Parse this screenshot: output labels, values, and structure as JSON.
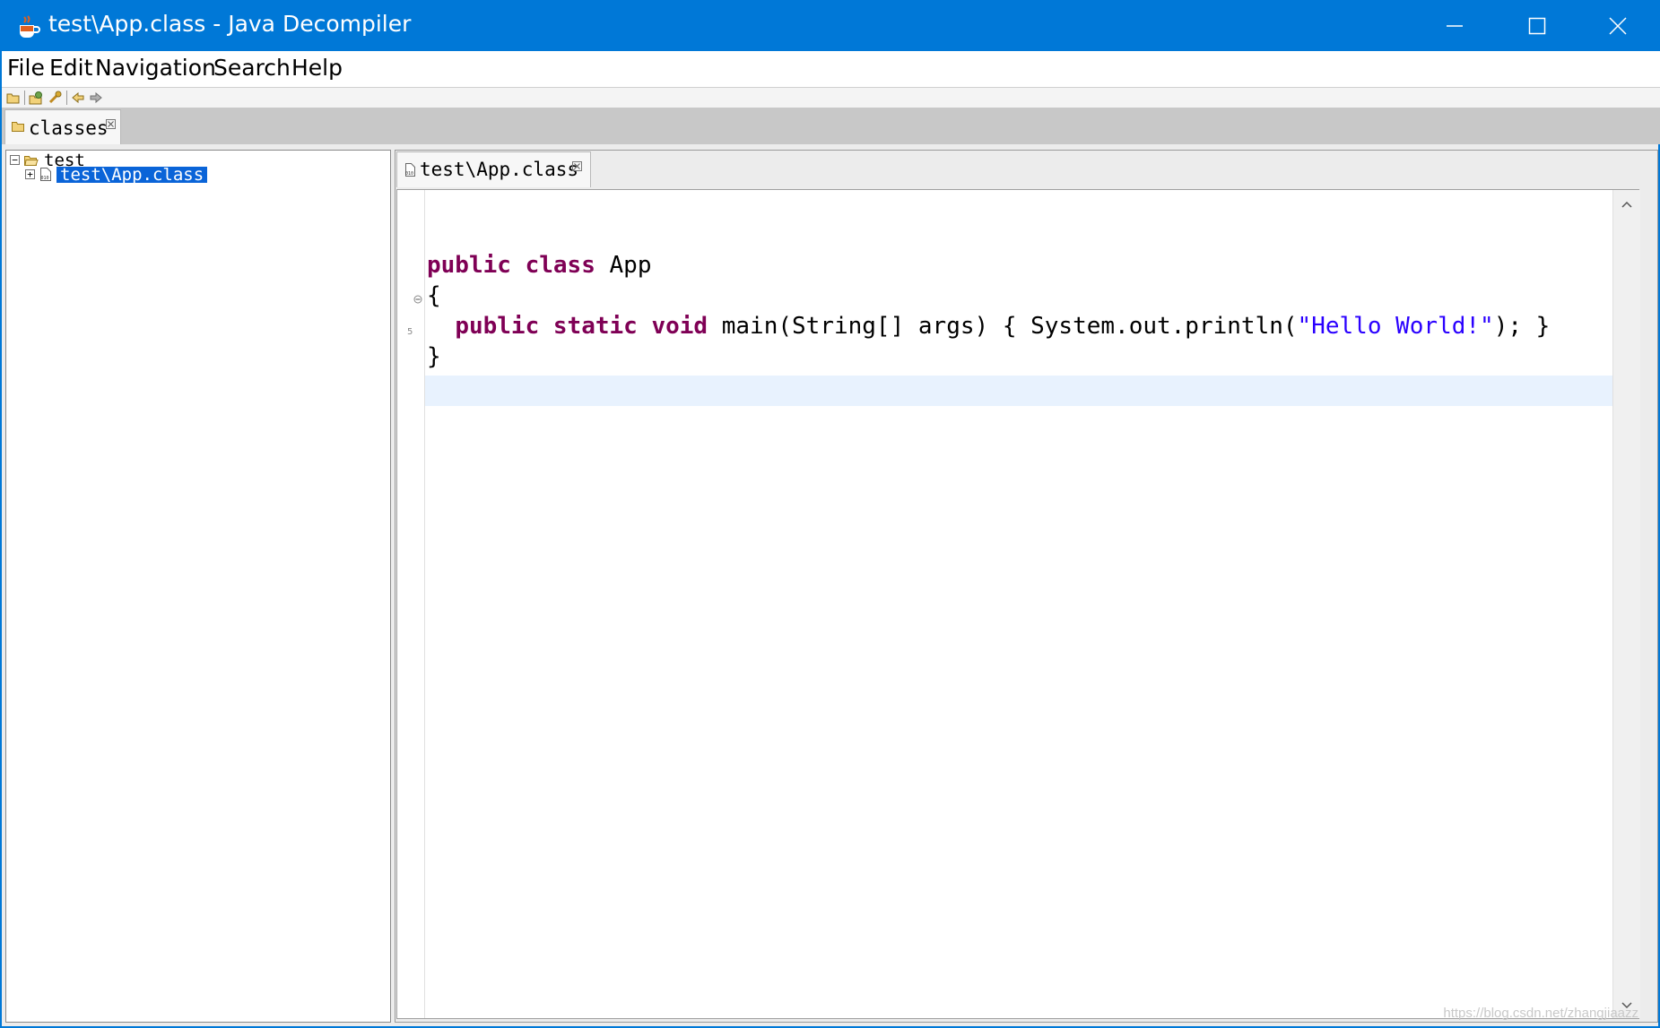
{
  "window": {
    "title": "test\\App.class - Java Decompiler",
    "accent_color": "#0078d7"
  },
  "menu": {
    "items": [
      "File",
      "Edit",
      "Navigation",
      "Search",
      "Help"
    ]
  },
  "toolbar": {
    "icons": [
      "open-file-icon",
      "open-type-icon",
      "search-icon",
      "back-icon",
      "forward-icon"
    ]
  },
  "outer_tab": {
    "label": "classes",
    "icon": "folder-icon"
  },
  "tree": {
    "root_label": "test",
    "child_label": "test\\App.class"
  },
  "editor": {
    "tab_label": "test\\App.class",
    "line_number_label": "5",
    "code": {
      "kw_public": "public",
      "kw_class": "class",
      "class_name": " App",
      "open_brace": "{",
      "kw_static": "static",
      "kw_void": "void",
      "main_sig": " main(String[] args) { System.out.println(",
      "string_literal": "\"Hello World!\"",
      "main_end": "); }",
      "close_brace": "}"
    },
    "keyword_color": "#7f0055",
    "string_color": "#2a00ff"
  },
  "watermark": "https://blog.csdn.net/zhangjiaazz"
}
